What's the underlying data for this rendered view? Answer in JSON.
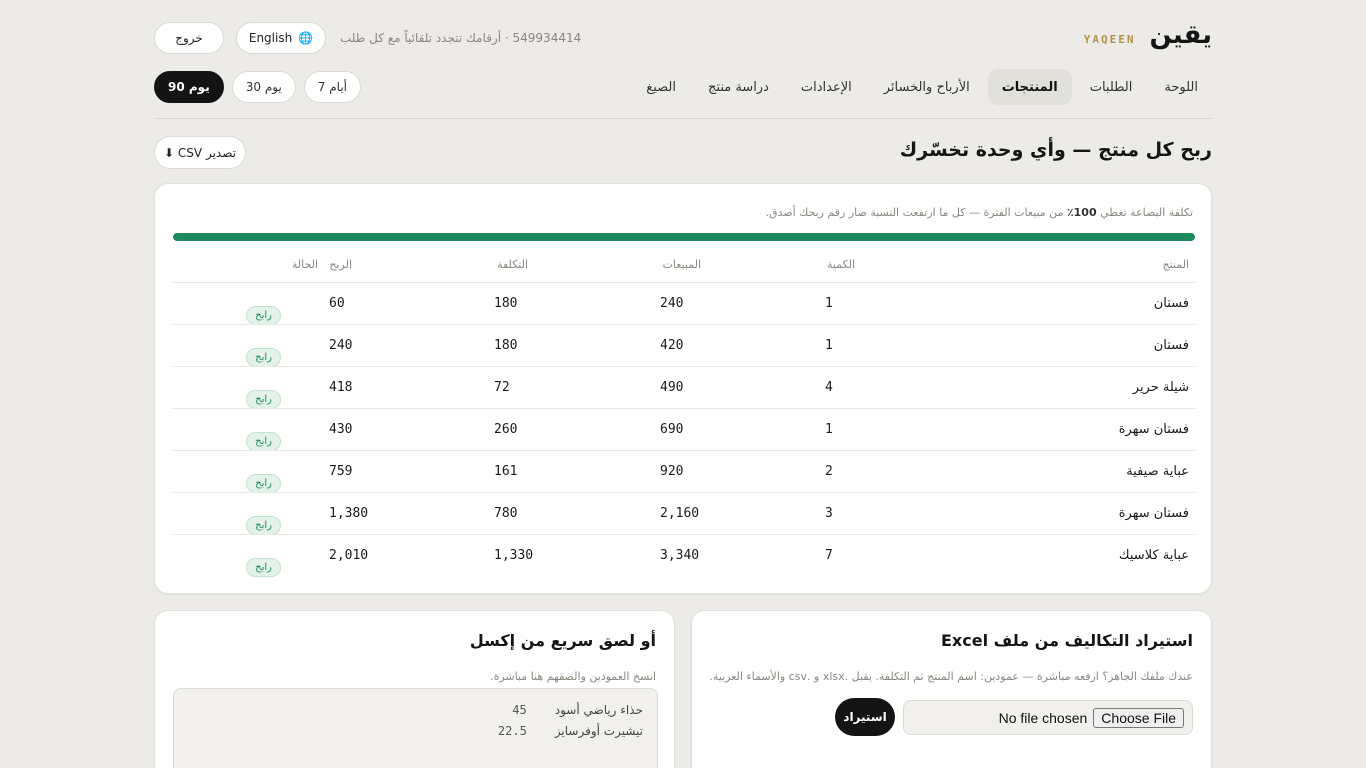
{
  "brand": {
    "name_ar": "يقين",
    "name_en": "YAQEEN"
  },
  "header": {
    "tagline": "549934414 · أرقامك تتجدد تلقائياً مع كل طلب",
    "language_label": "English",
    "logout_label": "خروج"
  },
  "nav": {
    "items": [
      {
        "label": "اللوحة"
      },
      {
        "label": "الطلبات"
      },
      {
        "label": "المنتجات"
      },
      {
        "label": "الأرباح والخسائر"
      },
      {
        "label": "الإعدادات"
      },
      {
        "label": "دراسة منتج"
      },
      {
        "label": "الصيغ"
      }
    ],
    "active_index": 2
  },
  "ranges": {
    "items": [
      {
        "label": "90 يوم"
      },
      {
        "label": "30 يوم"
      },
      {
        "label": "7 أيام"
      }
    ],
    "active_index": 0
  },
  "section": {
    "title": "ربح كل منتج — وأي وحدة تخسّرك",
    "export_label": "تصدير CSV ⬇"
  },
  "coverage": {
    "prefix": "تكلفة البضاعة تغطي",
    "percent_text": "100٪",
    "suffix": "من مبيعات الفترة — كل ما ارتفعت النسبة صار رقم ربحك أصدق.",
    "percent": 100
  },
  "table": {
    "headers": {
      "product": "المنتج",
      "qty": "الكمية",
      "sales": "المبيعات",
      "cost": "التكلفة",
      "profit": "الربح",
      "status": "الحالة"
    },
    "rows": [
      {
        "product": "فستان",
        "qty": "1",
        "sales": "240",
        "cost": "180",
        "profit": "60",
        "status": "رابح"
      },
      {
        "product": "فستان",
        "qty": "1",
        "sales": "420",
        "cost": "180",
        "profit": "240",
        "status": "رابح"
      },
      {
        "product": "شيلة حرير",
        "qty": "4",
        "sales": "490",
        "cost": "72",
        "profit": "418",
        "status": "رابح"
      },
      {
        "product": "فستان سهرة",
        "qty": "1",
        "sales": "690",
        "cost": "260",
        "profit": "430",
        "status": "رابح"
      },
      {
        "product": "عباية صيفية",
        "qty": "2",
        "sales": "920",
        "cost": "161",
        "profit": "759",
        "status": "رابح"
      },
      {
        "product": "فستان سهرة",
        "qty": "3",
        "sales": "2,160",
        "cost": "780",
        "profit": "1,380",
        "status": "رابح"
      },
      {
        "product": "عباية كلاسيك",
        "qty": "7",
        "sales": "3,340",
        "cost": "1,330",
        "profit": "2,010",
        "status": "رابح"
      }
    ]
  },
  "import": {
    "title": "استيراد التكاليف من ملف Excel",
    "subtitle": "عندك ملفك الجاهز؟ ارفعه مباشرة — عمودين: اسم المنتج ثم التكلفة. يقبل .xlsx و .csv والأسماء العربية.",
    "choose_label": "Choose File",
    "no_file_label": "No file chosen",
    "import_button": "استيراد"
  },
  "paste": {
    "title": "أو لصق سريع من إكسل",
    "subtitle": "انسخ العمودين والصقهم هنا مباشرة.",
    "lines": [
      {
        "name": "حذاء رياضي أسود",
        "value": "45"
      },
      {
        "name": "تيشيرت أوفرسايز",
        "value": "22.5"
      }
    ]
  },
  "colors": {
    "accent": "#1c8a5a",
    "brand_en": "#b69349",
    "dark": "#141414"
  }
}
